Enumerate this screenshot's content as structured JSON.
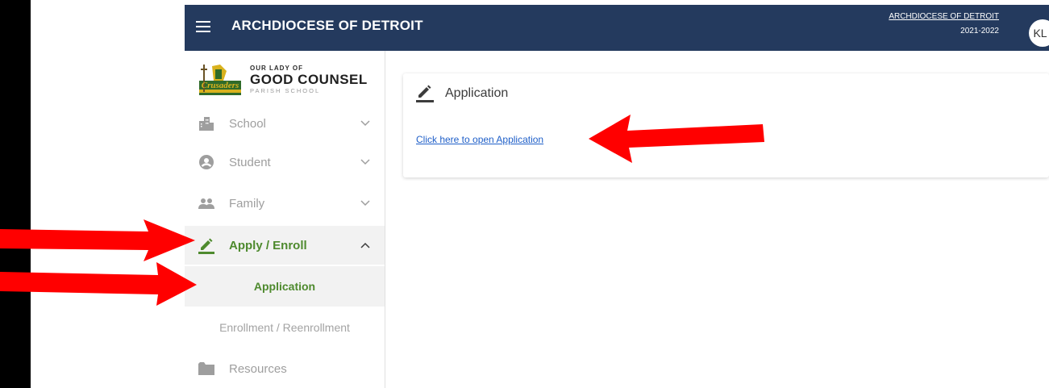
{
  "topbar": {
    "title": "ARCHDIOCESE OF DETROIT",
    "org_link": "ARCHDIOCESE OF DETROIT",
    "year": "2021-2022",
    "avatar_initials": "KL",
    "bg_color": "#243a5e"
  },
  "logo": {
    "small": "OUR LADY OF",
    "big": "GOOD COUNSEL",
    "sub": "PARISH SCHOOL"
  },
  "sidebar": {
    "items": [
      {
        "label": "School",
        "icon": "building-icon"
      },
      {
        "label": "Student",
        "icon": "account-circle-icon"
      },
      {
        "label": "Family",
        "icon": "people-icon"
      },
      {
        "label": "Apply / Enroll",
        "icon": "pencil-icon",
        "active": true
      },
      {
        "label": "Resources",
        "icon": "folder-icon"
      }
    ],
    "subitems": [
      {
        "label": "Application",
        "active": true
      },
      {
        "label": "Enrollment / Reenrollment"
      }
    ],
    "accent_color": "#4e8a2e"
  },
  "card": {
    "title": "Application",
    "link_text": "Click here to open Application"
  },
  "annotation_color": "#ff0000"
}
